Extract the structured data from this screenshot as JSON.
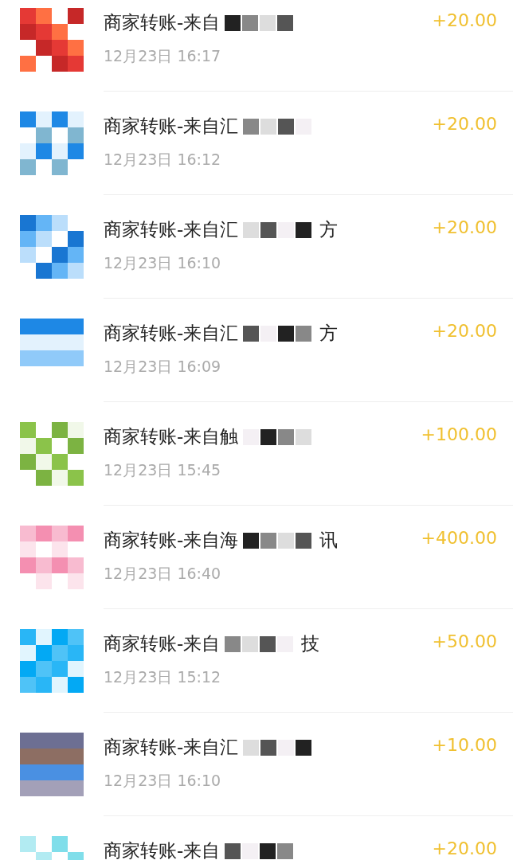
{
  "transactions": [
    {
      "title": "商家转账-来自",
      "time": "12月23日 16:17",
      "amount": "+20.00"
    },
    {
      "title": "商家转账-来自汇",
      "time": "12月23日 16:12",
      "amount": "+20.00"
    },
    {
      "title": "商家转账-来自汇",
      "tail": "方",
      "time": "12月23日 16:10",
      "amount": "+20.00"
    },
    {
      "title": "商家转账-来自汇",
      "tail": "方",
      "time": "12月23日 16:09",
      "amount": "+20.00"
    },
    {
      "title": "商家转账-来自触",
      "time": "12月23日 15:45",
      "amount": "+100.00"
    },
    {
      "title": "商家转账-来自海",
      "tail": "讯",
      "time": "12月23日 16:40",
      "amount": "+400.00"
    },
    {
      "title": "商家转账-来自",
      "tail": "技",
      "time": "12月23日 15:12",
      "amount": "+50.00"
    },
    {
      "title": "商家转账-来自汇",
      "time": "12月23日 16:10",
      "amount": "+10.00"
    },
    {
      "title": "商家转账-来自",
      "amount": "+20.00"
    }
  ]
}
